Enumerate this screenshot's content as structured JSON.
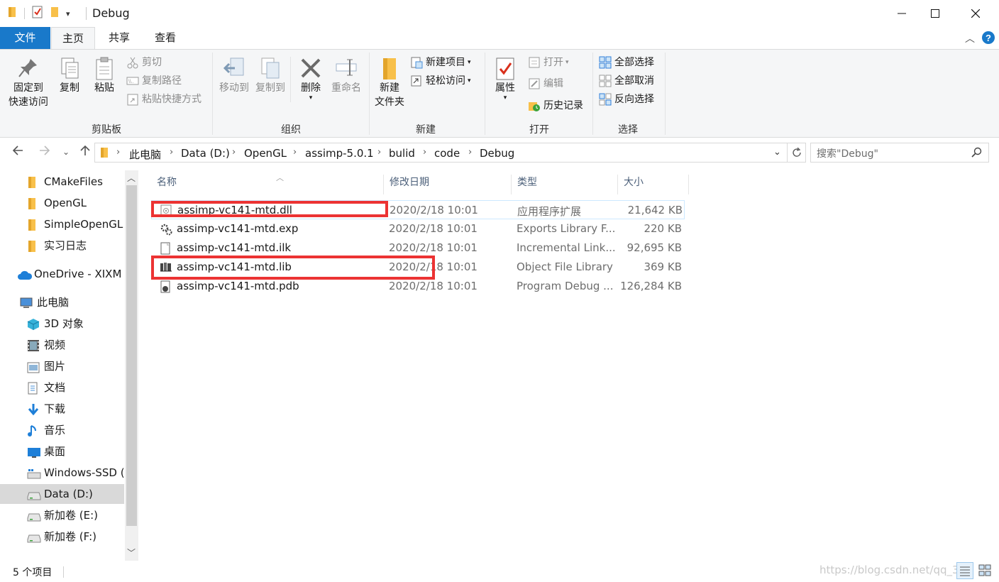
{
  "window": {
    "title": "Debug",
    "minimize_glyph": "—",
    "maximize_glyph": "☐",
    "close_glyph": "✕"
  },
  "ribbon_tabs": {
    "file": "文件",
    "home": "主页",
    "share": "共享",
    "view": "查看"
  },
  "ribbon": {
    "clipboard": {
      "label": "剪贴板",
      "pin_line1": "固定到",
      "pin_line2": "快速访问",
      "copy": "复制",
      "paste": "粘贴",
      "cut": "剪切",
      "copy_path": "复制路径",
      "paste_shortcut": "粘贴快捷方式"
    },
    "organize": {
      "label": "组织",
      "move_to": "移动到",
      "copy_to": "复制到",
      "delete": "删除",
      "rename": "重命名"
    },
    "new": {
      "label": "新建",
      "new_folder_line1": "新建",
      "new_folder_line2": "文件夹",
      "new_item": "新建项目",
      "easy_access": "轻松访问"
    },
    "open": {
      "label": "打开",
      "properties": "属性",
      "open": "打开",
      "edit": "编辑",
      "history": "历史记录"
    },
    "select": {
      "label": "选择",
      "select_all": "全部选择",
      "select_none": "全部取消",
      "invert": "反向选择"
    }
  },
  "address": {
    "crumbs": [
      "此电脑",
      "Data (D:)",
      "OpenGL",
      "assimp-5.0.1",
      "bulid",
      "code",
      "Debug"
    ],
    "search_placeholder": "搜索\"Debug\""
  },
  "nav": {
    "items": [
      {
        "label": "CMakeFiles",
        "icon": "folder-icon"
      },
      {
        "label": "OpenGL",
        "icon": "folder-icon"
      },
      {
        "label": "SimpleOpenGL",
        "icon": "folder-icon"
      },
      {
        "label": "实习日志",
        "icon": "folder-icon"
      },
      {
        "label": "OneDrive - XIXM",
        "icon": "cloud-icon"
      },
      {
        "label": "此电脑",
        "icon": "computer-icon"
      },
      {
        "label": "3D 对象",
        "icon": "cube-icon"
      },
      {
        "label": "视频",
        "icon": "video-icon"
      },
      {
        "label": "图片",
        "icon": "picture-icon"
      },
      {
        "label": "文档",
        "icon": "document-icon"
      },
      {
        "label": "下载",
        "icon": "download-icon"
      },
      {
        "label": "音乐",
        "icon": "music-icon"
      },
      {
        "label": "桌面",
        "icon": "desktop-icon"
      },
      {
        "label": "Windows-SSD (",
        "icon": "windows-drive-icon"
      },
      {
        "label": "Data (D:)",
        "icon": "drive-icon"
      },
      {
        "label": "新加卷 (E:)",
        "icon": "drive-icon"
      },
      {
        "label": "新加卷 (F:)",
        "icon": "drive-icon"
      }
    ]
  },
  "files": {
    "columns": {
      "name": "名称",
      "date": "修改日期",
      "type": "类型",
      "size": "大小"
    },
    "rows": [
      {
        "name": "assimp-vc141-mtd.dll",
        "date": "2020/2/18 10:01",
        "type": "应用程序扩展",
        "size": "21,642 KB",
        "icon": "dll-file-icon"
      },
      {
        "name": "assimp-vc141-mtd.exp",
        "date": "2020/2/18 10:01",
        "type": "Exports Library F...",
        "size": "220 KB",
        "icon": "exp-file-icon"
      },
      {
        "name": "assimp-vc141-mtd.ilk",
        "date": "2020/2/18 10:01",
        "type": "Incremental Link...",
        "size": "92,695 KB",
        "icon": "ilk-file-icon"
      },
      {
        "name": "assimp-vc141-mtd.lib",
        "date": "2020/2/18 10:01",
        "type": "Object File Library",
        "size": "369 KB",
        "icon": "lib-file-icon"
      },
      {
        "name": "assimp-vc141-mtd.pdb",
        "date": "2020/2/18 10:01",
        "type": "Program Debug ...",
        "size": "126,284 KB",
        "icon": "pdb-file-icon"
      }
    ]
  },
  "status": {
    "count": "5 个项目",
    "watermark": "https://blog.csdn.net/qq_36"
  },
  "colors": {
    "accent": "#1979ca",
    "highlight": "#ec3333",
    "folder": "#f8c04a"
  }
}
